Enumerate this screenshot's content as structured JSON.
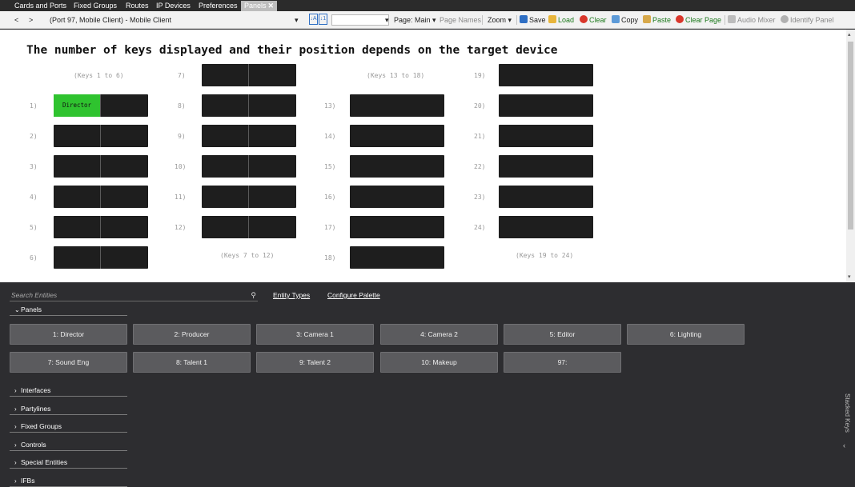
{
  "tabs": [
    {
      "label": "Cards and Ports"
    },
    {
      "label": "Fixed Groups"
    },
    {
      "label": "Routes"
    },
    {
      "label": "IP Devices"
    },
    {
      "label": "Preferences"
    },
    {
      "label": "Panels"
    }
  ],
  "toolbar": {
    "back": "<",
    "forward": ">",
    "device": "(Port 97, Mobile Client)  -  Mobile Client",
    "page": "Page: Main",
    "page_names": "Page Names",
    "zoom": "Zoom",
    "save": "Save",
    "load": "Load",
    "clear": "Clear",
    "copy": "Copy",
    "paste": "Paste",
    "clear_page": "Clear Page",
    "audio_mixer": "Audio Mixer",
    "identify_panel": "Identify Panel"
  },
  "canvas": {
    "headline": "The number of keys displayed and their position depends on the target device",
    "group_captions": [
      "(Keys 1 to 6)",
      "(Keys 13 to 18)",
      "(Keys 7 to 12)",
      "(Keys 19 to 24)"
    ],
    "key_numbers": [
      "1)",
      "2)",
      "3)",
      "4)",
      "5)",
      "6)",
      "7)",
      "8)",
      "9)",
      "10)",
      "11)",
      "12)",
      "13)",
      "14)",
      "15)",
      "16)",
      "17)",
      "18)",
      "19)",
      "20)",
      "21)",
      "22)",
      "23)",
      "24)"
    ],
    "assigned_key": {
      "label": "Director",
      "color": "#2fc32f"
    }
  },
  "palette": {
    "search_placeholder": "Search Entities",
    "entity_types": "Entity Types",
    "configure_palette": "Configure Palette",
    "panels_section": "Panels",
    "panel_buttons": [
      "1: Director",
      "2: Producer",
      "3: Camera 1",
      "4: Camera 2",
      "5: Editor",
      "6: Lighting",
      "7: Sound Eng",
      "8: Talent 1",
      "9: Talent 2",
      "10: Makeup",
      "97:"
    ],
    "sections": [
      "Interfaces",
      "Partylines",
      "Fixed Groups",
      "Controls",
      "Special Entities",
      "IFBs"
    ],
    "stacked_keys": "Stacked Keys"
  }
}
